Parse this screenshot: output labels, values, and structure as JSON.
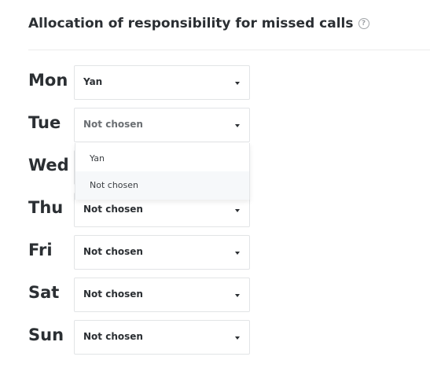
{
  "header": {
    "title": "Allocation of responsibility for missed calls",
    "help_icon": "help-circle-icon"
  },
  "schedule": [
    {
      "day": "Mon",
      "value": "Yan"
    },
    {
      "day": "Tue",
      "value": "Not chosen"
    },
    {
      "day": "Wed",
      "value": ""
    },
    {
      "day": "Thu",
      "value": "Not chosen"
    },
    {
      "day": "Fri",
      "value": "Not chosen"
    },
    {
      "day": "Sat",
      "value": "Not chosen"
    },
    {
      "day": "Sun",
      "value": "Not chosen"
    }
  ],
  "dropdown": {
    "open_for": "Tue",
    "options": [
      "Yan",
      "Not chosen"
    ],
    "hovered_option": "Not chosen"
  },
  "colors": {
    "text": "#2b2f33",
    "border": "#e2e4e6",
    "hover_bg": "#f6f8fa"
  }
}
